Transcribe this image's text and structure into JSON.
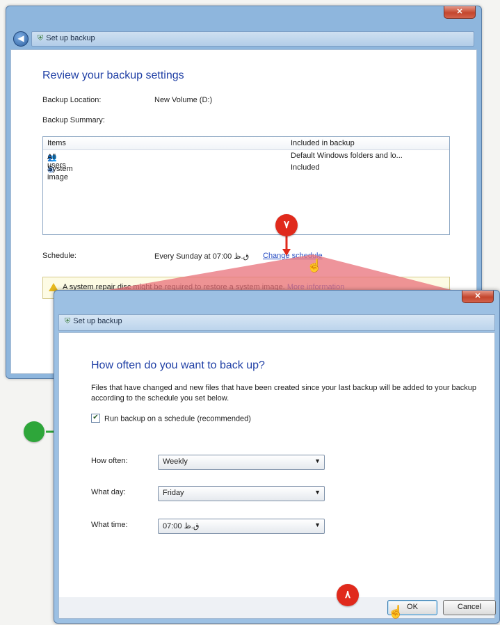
{
  "back_window": {
    "breadcrumb": "Set up backup",
    "close_glyph": "✕",
    "back_glyph": "◀",
    "title": "Review your backup settings",
    "backup_location_label": "Backup Location:",
    "backup_location_value": "New Volume (D:)",
    "backup_summary_label": "Backup Summary:",
    "items_table": {
      "col_items": "Items",
      "col_included": "Included in backup",
      "rows": [
        {
          "icon": "users-icon",
          "item": "All users",
          "included": "Default Windows folders and lo..."
        },
        {
          "icon": "system-image-icon",
          "item": "System image",
          "included": "Included"
        }
      ]
    },
    "schedule_label": "Schedule:",
    "schedule_value": "Every Sunday at 07:00 ق.ظ",
    "change_schedule_link": "Change schedule",
    "warning_text": "A system repair disc might be required to restore a system image.",
    "more_info_link": "More information"
  },
  "dialog": {
    "breadcrumb": "Set up backup",
    "close_glyph": "✕",
    "title": "How often do you want to back up?",
    "description": "Files that have changed and new files that have been created since your last backup will be added to your backup according to the schedule you set below.",
    "run_on_schedule_label": "Run backup on a schedule (recommended)",
    "run_on_schedule_checked": true,
    "how_often_label": "How often:",
    "how_often_value": "Weekly",
    "what_day_label": "What day:",
    "what_day_value": "Friday",
    "what_time_label": "What time:",
    "what_time_value": "07:00 ق.ظ",
    "ok_label": "OK",
    "cancel_label": "Cancel"
  },
  "annotations": {
    "step_7": "۷",
    "step_8": "۸",
    "arrow_color": "#e02a1c",
    "check_arrow_color": "#2ea63a",
    "wedge_color": "#e8707a"
  }
}
